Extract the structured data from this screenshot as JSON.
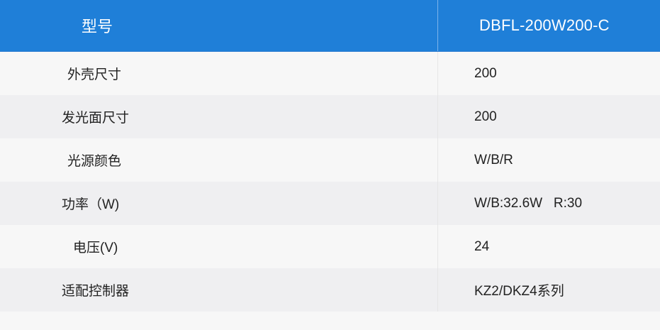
{
  "header": {
    "label": "型号",
    "value": "DBFL-200W200-C"
  },
  "rows": [
    {
      "label": "外壳尺寸",
      "value": "200"
    },
    {
      "label": "发光面尺寸",
      "value": "200"
    },
    {
      "label": "光源颜色",
      "value": "W/B/R"
    },
    {
      "label": "功率（W)",
      "value": "W/B:32.6W   R:30"
    },
    {
      "label": "电压(V)",
      "value": "24"
    },
    {
      "label": "适配控制器",
      "value": "KZ2/DKZ4系列"
    }
  ],
  "colors": {
    "header_bg": "#1f7fd8",
    "row_odd": "#f7f7f7",
    "row_even": "#efeff1"
  }
}
